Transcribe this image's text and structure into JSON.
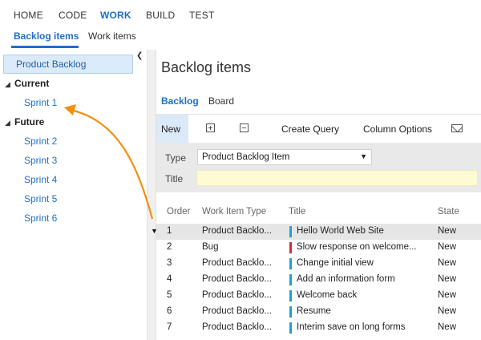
{
  "topnav": {
    "items": [
      {
        "label": "HOME"
      },
      {
        "label": "CODE"
      },
      {
        "label": "WORK"
      },
      {
        "label": "BUILD"
      },
      {
        "label": "TEST"
      }
    ],
    "active": "WORK"
  },
  "subnav": {
    "tabs": [
      {
        "label": "Backlog items"
      },
      {
        "label": "Work items"
      }
    ],
    "active": "Backlog items"
  },
  "sidebar": {
    "selected": "Product Backlog",
    "groups": [
      {
        "label": "Current",
        "sprints": [
          "Sprint 1"
        ]
      },
      {
        "label": "Future",
        "sprints": [
          "Sprint 2",
          "Sprint 3",
          "Sprint 4",
          "Sprint 5",
          "Sprint 6"
        ]
      }
    ]
  },
  "main": {
    "title": "Backlog items",
    "pivots": [
      {
        "label": "Backlog"
      },
      {
        "label": "Board"
      }
    ],
    "active_pivot": "Backlog"
  },
  "toolbar": {
    "new_label": "New",
    "expand_icon": "expand-all-icon",
    "collapse_icon": "collapse-all-icon",
    "create_query_label": "Create Query",
    "column_options_label": "Column Options",
    "email_icon": "mail-icon"
  },
  "quickadd": {
    "type_label": "Type",
    "type_value": "Product Backlog Item",
    "title_label": "Title",
    "title_value": ""
  },
  "grid": {
    "headers": [
      "Order",
      "Work Item Type",
      "Title",
      "State"
    ],
    "rows": [
      {
        "order": "1",
        "type": "Product Backlo...",
        "title": "Hello World Web Site",
        "state": "New",
        "color": "#1ea0d2"
      },
      {
        "order": "2",
        "type": "Bug",
        "title": "Slow response on welcome...",
        "state": "New",
        "color": "#cc2f3f"
      },
      {
        "order": "3",
        "type": "Product Backlo...",
        "title": "Change initial view",
        "state": "New",
        "color": "#1ea0d2"
      },
      {
        "order": "4",
        "type": "Product Backlo...",
        "title": "Add an information form",
        "state": "New",
        "color": "#1ea0d2"
      },
      {
        "order": "5",
        "type": "Product Backlo...",
        "title": "Welcome back",
        "state": "New",
        "color": "#1ea0d2"
      },
      {
        "order": "6",
        "type": "Product Backlo...",
        "title": "Resume",
        "state": "New",
        "color": "#1ea0d2"
      },
      {
        "order": "7",
        "type": "Product Backlo...",
        "title": "Interim save on long forms",
        "state": "New",
        "color": "#1ea0d2"
      }
    ]
  },
  "colors": {
    "accent": "#1f6fc5",
    "selection": "#dbeaf8",
    "annotation_arrow": "#f29111"
  }
}
